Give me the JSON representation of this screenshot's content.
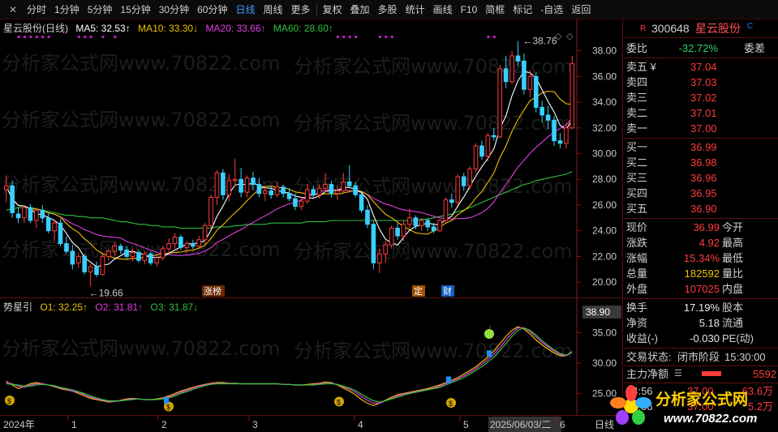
{
  "toolbar": {
    "items": [
      "分时",
      "1分钟",
      "5分钟",
      "15分钟",
      "30分钟",
      "60分钟",
      "日线",
      "周线",
      "更多",
      "复权",
      "叠加",
      "多股",
      "统计",
      "画线",
      "F10",
      "简框",
      "标记",
      "-自选",
      "返回"
    ],
    "active_index": 6
  },
  "main_legend": {
    "name": "星云股份(日线)",
    "ma5": "MA5: 32.53↑",
    "ma10": "MA10: 33.30↓",
    "ma20": "MA20: 33.66↑",
    "ma60": "MA60: 28.60↑"
  },
  "sub_legend": {
    "name": "势星引",
    "o1": "O1: 32.25↑",
    "o2": "O2: 31.81↑",
    "o3": "O3: 31.87↓"
  },
  "colors": {
    "ma5": "#ffffff",
    "ma10": "#f0c000",
    "ma20": "#e040e0",
    "ma60": "#30c040",
    "up": "#ff3b3b",
    "down": "#38d0ff"
  },
  "annotations": {
    "high": "38.76",
    "low": "19.66",
    "tag_zhang": "涨榜",
    "tag_ding": "定",
    "tag_cai": "财",
    "cursor_value": "38.90"
  },
  "time_axis": [
    "2024年",
    "1",
    "2",
    "3",
    "4",
    "5",
    "2025/06/03/二",
    "6",
    "日线"
  ],
  "quote": {
    "header_tag": "R",
    "code": "300648",
    "name": "星云股份",
    "weibi_label": "委比",
    "weibi": "-32.72%",
    "weicha_label": "委差",
    "asks": [
      {
        "label": "卖五 ¥",
        "price": "37.04"
      },
      {
        "label": "卖四",
        "price": "37.03"
      },
      {
        "label": "卖三",
        "price": "37.02"
      },
      {
        "label": "卖二",
        "price": "37.01"
      },
      {
        "label": "卖一",
        "price": "37.00"
      }
    ],
    "bids": [
      {
        "label": "买一",
        "price": "36.99"
      },
      {
        "label": "买二",
        "price": "36.98"
      },
      {
        "label": "买三",
        "price": "36.96"
      },
      {
        "label": "买四",
        "price": "36.95"
      },
      {
        "label": "买五",
        "price": "36.90"
      }
    ],
    "stats": [
      {
        "l": "现价",
        "v": "36.99",
        "c": "red",
        "l2": "今开"
      },
      {
        "l": "涨跌",
        "v": "4.92",
        "c": "red",
        "l2": "最高"
      },
      {
        "l": "涨幅",
        "v": "15.34%",
        "c": "red",
        "l2": "最低"
      },
      {
        "l": "总量",
        "v": "182592",
        "c": "yellow",
        "l2": "量比"
      },
      {
        "l": "外盘",
        "v": "107025",
        "c": "red",
        "l2": "内盘"
      }
    ],
    "stats2": [
      {
        "l": "换手",
        "v": "17.19%",
        "l2": "股本"
      },
      {
        "l": "净资",
        "v": "5.18",
        "l2": "流通"
      },
      {
        "l": "收益(-)",
        "v": "-0.030",
        "l2": "PE(动)"
      }
    ],
    "status_label": "交易状态:",
    "status_value": "闭市阶段",
    "status_time": "15:30:00",
    "net_label": "主力净额",
    "net_value": "5592",
    "ticks": [
      {
        "t": "14:56",
        "p": "37.00",
        "v": "63.6万"
      },
      {
        "t": "14:56",
        "p": "37.00",
        "v": "5.2万"
      }
    ]
  },
  "logo": {
    "title": "分析家公式网",
    "url": "www.70822.com"
  },
  "chart_data": [
    {
      "type": "candlestick",
      "title": "星云股份(日线)",
      "y_ticks": [
        20.0,
        22.0,
        24.0,
        26.0,
        28.0,
        30.0,
        32.0,
        34.0,
        36.0,
        38.0
      ],
      "ylim": [
        19.0,
        39.3
      ],
      "x_labels": [
        "2024年",
        "1",
        "2",
        "3",
        "4",
        "5",
        "6"
      ],
      "candles": [
        [
          27.2,
          28.3,
          26.2,
          27.5
        ],
        [
          27.5,
          27.9,
          25.0,
          25.4
        ],
        [
          25.3,
          25.8,
          24.6,
          25.0
        ],
        [
          25.0,
          26.0,
          24.6,
          25.8
        ],
        [
          25.8,
          26.1,
          24.6,
          24.8
        ],
        [
          24.8,
          25.8,
          24.2,
          25.6
        ],
        [
          25.6,
          26.0,
          24.6,
          25.0
        ],
        [
          25.0,
          25.4,
          23.8,
          24.0
        ],
        [
          24.0,
          24.8,
          23.2,
          24.6
        ],
        [
          24.6,
          24.9,
          22.8,
          23.0
        ],
        [
          23.0,
          23.6,
          22.2,
          22.4
        ],
        [
          22.4,
          22.9,
          21.0,
          21.4
        ],
        [
          21.5,
          22.3,
          21.1,
          22.0
        ],
        [
          22.0,
          22.2,
          20.6,
          20.8
        ],
        [
          20.8,
          21.4,
          19.66,
          21.2
        ],
        [
          21.2,
          21.6,
          20.4,
          20.6
        ],
        [
          20.6,
          22.3,
          20.5,
          22.0
        ],
        [
          22.0,
          22.6,
          21.7,
          22.4
        ],
        [
          22.4,
          23.1,
          22.0,
          22.8
        ],
        [
          22.8,
          23.0,
          22.2,
          22.5
        ],
        [
          22.5,
          22.8,
          21.8,
          22.0
        ],
        [
          22.0,
          22.6,
          21.6,
          22.3
        ],
        [
          22.3,
          22.5,
          21.5,
          21.7
        ],
        [
          21.7,
          22.4,
          21.4,
          22.2
        ],
        [
          22.2,
          22.4,
          21.3,
          21.5
        ],
        [
          21.5,
          22.1,
          21.2,
          21.9
        ],
        [
          21.9,
          22.8,
          21.7,
          22.6
        ],
        [
          22.6,
          23.4,
          22.3,
          23.0
        ],
        [
          23.0,
          23.8,
          22.6,
          23.5
        ],
        [
          23.5,
          23.7,
          22.5,
          22.7
        ],
        [
          22.7,
          23.2,
          22.3,
          23.0
        ],
        [
          23.0,
          23.3,
          22.6,
          22.8
        ],
        [
          22.8,
          23.6,
          22.6,
          23.3
        ],
        [
          23.3,
          24.6,
          23.0,
          24.4
        ],
        [
          24.4,
          26.8,
          24.1,
          26.6
        ],
        [
          26.6,
          28.7,
          26.0,
          28.5
        ],
        [
          28.5,
          28.8,
          26.4,
          26.8
        ],
        [
          26.8,
          28.4,
          26.3,
          27.9
        ],
        [
          27.9,
          29.6,
          27.5,
          28.0
        ],
        [
          28.0,
          28.9,
          26.6,
          27.0
        ],
        [
          27.0,
          28.3,
          26.6,
          28.1
        ],
        [
          28.1,
          28.6,
          27.2,
          27.6
        ],
        [
          27.6,
          28.1,
          26.6,
          26.9
        ],
        [
          26.9,
          27.4,
          26.3,
          27.1
        ],
        [
          27.1,
          27.5,
          26.5,
          26.8
        ],
        [
          26.8,
          27.8,
          26.6,
          27.4
        ],
        [
          27.4,
          27.6,
          26.6,
          26.9
        ],
        [
          26.9,
          27.3,
          26.3,
          26.5
        ],
        [
          26.5,
          26.9,
          25.6,
          25.9
        ],
        [
          25.9,
          26.6,
          25.6,
          26.3
        ],
        [
          26.3,
          27.6,
          26.1,
          27.2
        ],
        [
          27.2,
          27.5,
          26.6,
          26.8
        ],
        [
          26.8,
          27.6,
          26.5,
          27.3
        ],
        [
          27.3,
          28.5,
          27.0,
          27.6
        ],
        [
          27.6,
          27.9,
          26.6,
          26.9
        ],
        [
          26.9,
          27.5,
          26.4,
          27.1
        ],
        [
          27.1,
          28.5,
          26.9,
          27.8
        ],
        [
          27.8,
          29.1,
          27.3,
          27.5
        ],
        [
          27.5,
          27.8,
          26.6,
          26.8
        ],
        [
          26.8,
          26.9,
          25.4,
          25.6
        ],
        [
          25.6,
          26.0,
          24.2,
          24.5
        ],
        [
          24.5,
          24.8,
          21.0,
          21.5
        ],
        [
          21.5,
          22.6,
          20.7,
          22.2
        ],
        [
          22.2,
          23.2,
          21.5,
          22.9
        ],
        [
          22.9,
          24.4,
          22.6,
          24.2
        ],
        [
          24.2,
          24.6,
          23.3,
          23.6
        ],
        [
          23.6,
          24.8,
          23.2,
          24.5
        ],
        [
          24.5,
          25.7,
          24.2,
          25.0
        ],
        [
          25.0,
          25.2,
          24.1,
          24.4
        ],
        [
          24.4,
          25.0,
          24.0,
          24.8
        ],
        [
          24.8,
          25.0,
          24.0,
          24.3
        ],
        [
          24.3,
          24.6,
          23.8,
          24.0
        ],
        [
          24.0,
          24.9,
          23.9,
          24.8
        ],
        [
          24.8,
          26.6,
          24.6,
          26.4
        ],
        [
          26.4,
          26.9,
          25.8,
          26.2
        ],
        [
          26.2,
          28.4,
          26.0,
          28.2
        ],
        [
          28.2,
          28.5,
          27.1,
          27.5
        ],
        [
          27.5,
          29.0,
          27.2,
          28.8
        ],
        [
          28.8,
          30.8,
          28.5,
          30.6
        ],
        [
          30.6,
          31.0,
          29.5,
          29.8
        ],
        [
          29.8,
          31.6,
          29.4,
          31.4
        ],
        [
          31.4,
          32.0,
          31.0,
          31.3
        ],
        [
          31.3,
          36.9,
          31.2,
          36.6
        ],
        [
          36.6,
          37.6,
          35.1,
          35.6
        ],
        [
          35.6,
          38.0,
          35.4,
          37.6
        ],
        [
          37.6,
          38.76,
          36.8,
          37.2
        ],
        [
          37.2,
          37.8,
          34.6,
          35.0
        ],
        [
          35.0,
          36.5,
          34.4,
          36.0
        ],
        [
          36.0,
          36.3,
          33.2,
          33.6
        ],
        [
          33.6,
          34.1,
          32.4,
          33.0
        ],
        [
          33.0,
          33.7,
          31.9,
          32.6
        ],
        [
          32.6,
          32.9,
          30.6,
          31.0
        ],
        [
          31.0,
          31.6,
          30.4,
          30.8
        ],
        [
          30.8,
          32.4,
          30.4,
          32.0
        ],
        [
          32.0,
          37.6,
          31.9,
          36.99
        ]
      ],
      "ma60_series_start": [
        24.8,
        25.3,
        25.6,
        25.4,
        24.6,
        24.0,
        24.2,
        25.2,
        25.9,
        26.6,
        27.3,
        28.0,
        28.6
      ],
      "ma60": [
        25.6,
        25.7,
        25.8,
        25.8,
        25.8,
        25.7,
        25.6,
        25.5,
        25.4,
        25.3,
        25.2,
        25.2,
        25.1,
        25.1,
        25.0,
        25.0,
        25.0,
        24.9,
        24.8,
        24.7,
        24.7,
        24.6,
        24.5,
        24.5,
        24.4,
        24.4,
        24.3,
        24.3,
        24.3,
        24.2,
        24.2,
        24.2,
        24.2,
        24.2,
        24.2,
        24.3,
        24.3,
        24.3,
        24.4,
        24.4,
        24.5,
        24.5,
        24.5,
        24.5,
        24.6,
        24.6,
        24.6,
        24.6,
        24.6,
        24.6,
        24.7,
        24.7,
        24.7,
        24.7,
        24.8,
        24.8,
        24.8,
        24.8,
        24.8,
        24.8,
        24.8,
        24.8,
        24.8,
        24.8,
        24.8,
        24.8,
        24.8,
        24.8,
        24.8,
        24.9,
        24.9,
        25.0,
        25.1,
        25.2,
        25.3,
        25.5,
        25.6,
        25.8,
        26.0,
        26.2,
        26.4,
        26.6,
        26.8,
        27.0,
        27.2,
        27.4,
        27.6,
        27.7,
        27.9,
        28.0,
        28.1,
        28.2,
        28.3,
        28.4,
        28.6
      ]
    },
    {
      "type": "line",
      "title": "势星引",
      "y_ticks": [
        25.0,
        30.0,
        35.0
      ],
      "ylim": [
        22.0,
        38.0
      ],
      "series": [
        {
          "name": "O1",
          "values": [
            27.0,
            26.4,
            25.8,
            26.2,
            26.6,
            26.8,
            26.6,
            26.4,
            26.1,
            25.8,
            25.6,
            25.4,
            25.0,
            24.6,
            24.2,
            24.0,
            23.8,
            23.6,
            23.7,
            23.9,
            24.1,
            24.2,
            24.1,
            24.0,
            24.0,
            24.1,
            24.3,
            24.6,
            25.0,
            25.4,
            25.7,
            26.0,
            26.3,
            26.5,
            26.7,
            26.8,
            26.8,
            26.7,
            26.7,
            26.6,
            26.6,
            26.6,
            26.6,
            26.6,
            26.6,
            26.6,
            26.5,
            26.5,
            26.4,
            26.4,
            26.5,
            26.6,
            26.7,
            26.9,
            26.8,
            26.4,
            25.9,
            25.4,
            24.8,
            24.0,
            23.4,
            23.0,
            23.4,
            23.9,
            24.4,
            24.8,
            25.0,
            25.2,
            25.4,
            25.6,
            25.8,
            26.1,
            26.4,
            26.8,
            27.2,
            27.6,
            28.2,
            28.8,
            29.4,
            30.2,
            31.0,
            32.0,
            33.2,
            34.4,
            35.4,
            36.0,
            35.6,
            34.8,
            33.8,
            33.0,
            32.3,
            31.7,
            31.2,
            31.2,
            31.9
          ]
        },
        {
          "name": "O2",
          "values": [
            26.8,
            26.6,
            26.2,
            26.0,
            26.4,
            26.6,
            26.6,
            26.4,
            26.2,
            25.9,
            25.7,
            25.4,
            25.2,
            24.8,
            24.4,
            24.1,
            23.9,
            23.7,
            23.7,
            23.8,
            24.0,
            24.1,
            24.1,
            24.0,
            24.0,
            24.0,
            24.2,
            24.4,
            24.8,
            25.2,
            25.5,
            25.9,
            26.2,
            26.4,
            26.6,
            26.7,
            26.7,
            26.7,
            26.6,
            26.6,
            26.6,
            26.6,
            26.6,
            26.6,
            26.6,
            26.6,
            26.5,
            26.5,
            26.4,
            26.4,
            26.4,
            26.5,
            26.6,
            26.7,
            26.7,
            26.5,
            26.1,
            25.7,
            25.2,
            24.5,
            23.9,
            23.4,
            23.4,
            23.8,
            24.2,
            24.6,
            24.9,
            25.1,
            25.3,
            25.5,
            25.7,
            25.9,
            26.2,
            26.6,
            27.0,
            27.4,
            27.9,
            28.5,
            29.1,
            29.8,
            30.6,
            31.5,
            32.6,
            33.8,
            34.9,
            35.8,
            35.8,
            35.2,
            34.3,
            33.4,
            32.7,
            32.0,
            31.4,
            31.2,
            31.8
          ]
        },
        {
          "name": "O3",
          "values": [
            26.6,
            26.5,
            26.4,
            26.2,
            26.2,
            26.4,
            26.5,
            26.4,
            26.3,
            26.0,
            25.8,
            25.6,
            25.3,
            25.0,
            24.6,
            24.3,
            24.0,
            23.8,
            23.8,
            23.8,
            23.9,
            24.0,
            24.1,
            24.0,
            24.0,
            24.0,
            24.1,
            24.3,
            24.6,
            25.0,
            25.3,
            25.7,
            26.0,
            26.3,
            26.5,
            26.6,
            26.6,
            26.6,
            26.6,
            26.6,
            26.6,
            26.6,
            26.6,
            26.6,
            26.6,
            26.6,
            26.5,
            26.5,
            26.4,
            26.4,
            26.4,
            26.4,
            26.5,
            26.6,
            26.6,
            26.5,
            26.2,
            25.9,
            25.5,
            24.9,
            24.3,
            23.8,
            23.6,
            23.8,
            24.1,
            24.4,
            24.7,
            25.0,
            25.2,
            25.4,
            25.6,
            25.8,
            26.0,
            26.4,
            26.8,
            27.2,
            27.6,
            28.2,
            28.8,
            29.4,
            30.2,
            31.0,
            32.1,
            33.2,
            34.4,
            35.4,
            35.8,
            35.4,
            34.6,
            33.7,
            32.9,
            32.2,
            31.6,
            31.3,
            31.9
          ]
        }
      ]
    }
  ]
}
